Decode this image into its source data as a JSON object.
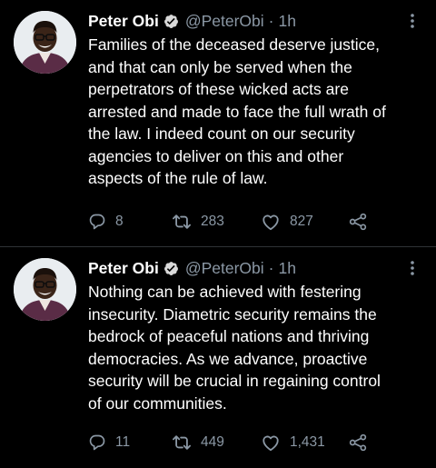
{
  "colors": {
    "background": "#000000",
    "text": "#ffffff",
    "muted": "#8b98a5",
    "verified": "#d9d9d9",
    "divider": "#2f3336"
  },
  "icons": {
    "verified": "verified-badge-icon",
    "more": "more-options-icon",
    "reply": "reply-icon",
    "retweet": "retweet-icon",
    "like": "heart-icon",
    "share": "share-icon"
  },
  "tweets": [
    {
      "author": {
        "name": "Peter Obi",
        "handle": "@PeterObi"
      },
      "separator": "·",
      "time": "1h",
      "text": "Families of the deceased deserve justice,\nand that can only be served when the\nperpetrators of these wicked acts are\narrested and made to face the full wrath of\nthe law. I indeed count on our security\nagencies to deliver on this and other\naspects of the rule of law.",
      "stats": {
        "replies": "8",
        "retweets": "283",
        "likes": "827"
      }
    },
    {
      "author": {
        "name": "Peter Obi",
        "handle": "@PeterObi"
      },
      "separator": "·",
      "time": "1h",
      "text": "Nothing can be achieved with festering\ninsecurity. Diametric security remains the\nbedrock of peaceful nations and thriving\ndemocracies.  As we advance, proactive\nsecurity will be crucial in regaining control\nof our communities.",
      "stats": {
        "replies": "11",
        "retweets": "449",
        "likes": "1,431"
      }
    }
  ]
}
